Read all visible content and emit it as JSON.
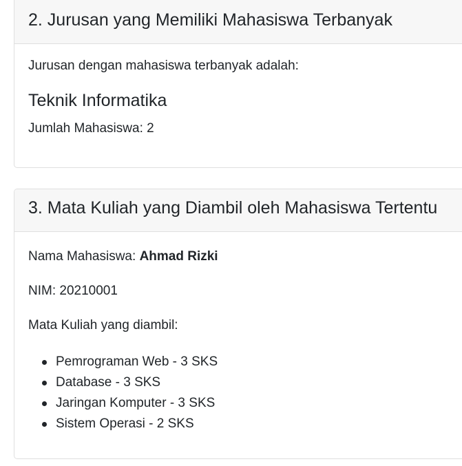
{
  "section_jurusan": {
    "title": "2. Jurusan yang Memiliki Mahasiswa Terbanyak",
    "intro": "Jurusan dengan mahasiswa terbanyak adalah:",
    "major_name": "Teknik Informatika",
    "count_text": "Jumlah Mahasiswa: 2"
  },
  "section_matakuliah": {
    "title": "3. Mata Kuliah yang Diambil oleh Mahasiswa Tertentu",
    "name_label": "Nama Mahasiswa: ",
    "name_value": "Ahmad Rizki",
    "nim_text": "NIM: 20210001",
    "courses_label": "Mata Kuliah yang diambil:",
    "courses": [
      "Pemrograman Web - 3 SKS",
      "Database - 3 SKS",
      "Jaringan Komputer - 3 SKS",
      "Sistem Operasi - 2 SKS"
    ]
  }
}
